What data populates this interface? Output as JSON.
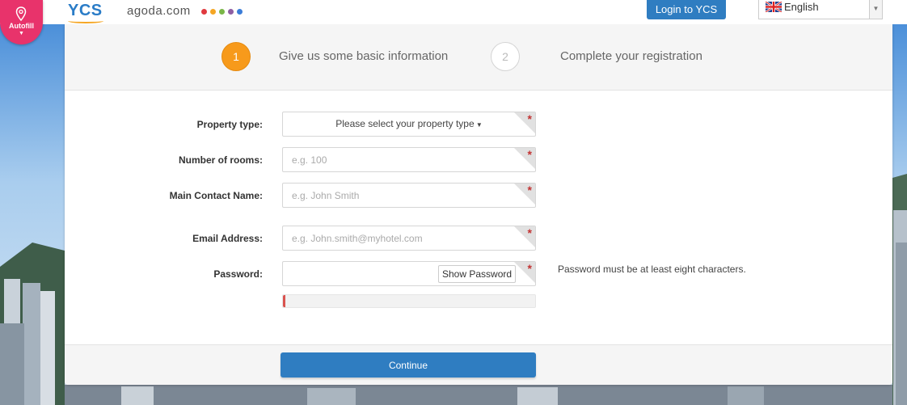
{
  "autofill": {
    "label": "Autofill",
    "icon": "map-pin-icon",
    "color": "#e8336b"
  },
  "header": {
    "ycs_logo": "YCS",
    "agoda_logo": "agoda.com",
    "agoda_dot_colors": [
      "#e0393e",
      "#f5a623",
      "#7ab648",
      "#8e5ea2",
      "#3b7dd8"
    ],
    "login_label": "Login to YCS",
    "language": {
      "selected": "English",
      "flag_icon": "uk-flag-icon"
    }
  },
  "steps": [
    {
      "number": "1",
      "label": "Give us some basic information",
      "active": true,
      "color": "#f79a1b"
    },
    {
      "number": "2",
      "label": "Complete your registration",
      "active": false
    }
  ],
  "form": {
    "property_type": {
      "label": "Property type:",
      "value": "Please select your property type",
      "required": true
    },
    "rooms": {
      "label": "Number of rooms:",
      "placeholder": "e.g. 100",
      "required": true
    },
    "contact_name": {
      "label": "Main Contact Name:",
      "placeholder": "e.g. John Smith",
      "required": true
    },
    "email": {
      "label": "Email Address:",
      "placeholder": "e.g. John.smith@myhotel.com",
      "required": true
    },
    "password": {
      "label": "Password:",
      "show_label": "Show Password",
      "hint": "Password must be at least eight characters.",
      "required": true,
      "strength_fraction": 0.01
    },
    "required_marker": "*"
  },
  "continue_label": "Continue",
  "colors": {
    "accent": "#2f7dc1",
    "required": "#c23333"
  }
}
